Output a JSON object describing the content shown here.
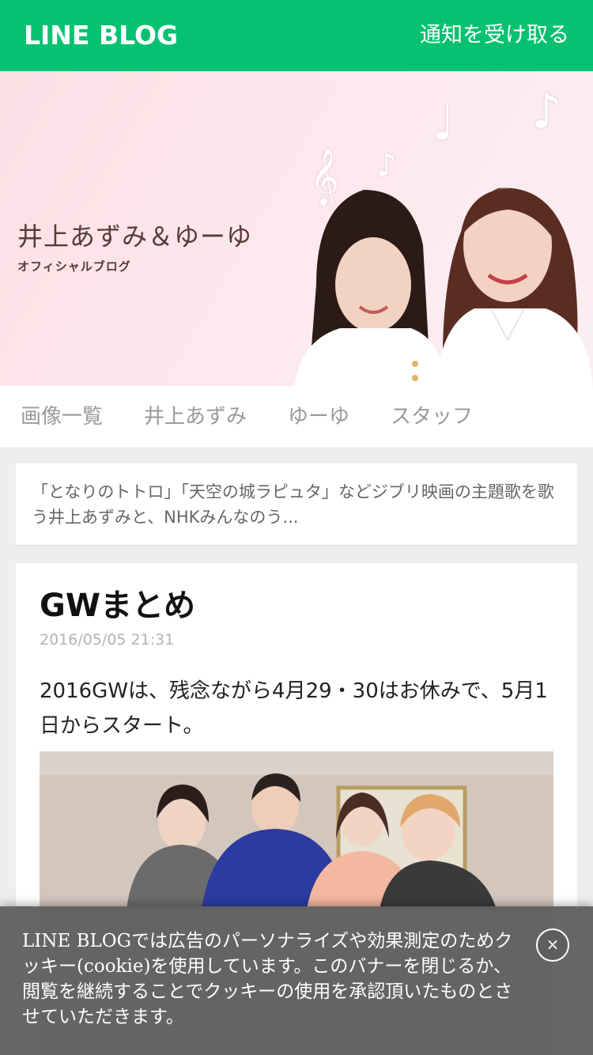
{
  "header": {
    "logo": "LINE BLOG",
    "notify_label": "通知を受け取る"
  },
  "banner": {
    "title": "井上あずみ＆ゆーゆ",
    "subtitle": "オフィシャルブログ"
  },
  "nav": {
    "items": [
      {
        "label": "画像一覧"
      },
      {
        "label": "井上あずみ"
      },
      {
        "label": "ゆーゆ"
      },
      {
        "label": "スタッフ"
      }
    ]
  },
  "description": "「となりのトトロ」「天空の城ラピュタ」などジブリ映画の主題歌を歌う井上あずみと、NHKみんなのう...",
  "post": {
    "title": "GWまとめ",
    "date": "2016/05/05 21:31",
    "body": "2016GWは、残念ながら4月29・30はお休みで、5月1日からスタート。"
  },
  "cookie_banner": {
    "text": "LINE BLOGでは広告のパーソナライズや効果測定のためクッキー(cookie)を使用しています。このバナーを閉じるか、閲覧を継続することでクッキーの使用を承認頂いたものとさせていただきます。",
    "close_label": "×"
  },
  "colors": {
    "brand_green": "#06c270",
    "banner_pink": "#fbe0e6",
    "cookie_bg": "#606060"
  }
}
